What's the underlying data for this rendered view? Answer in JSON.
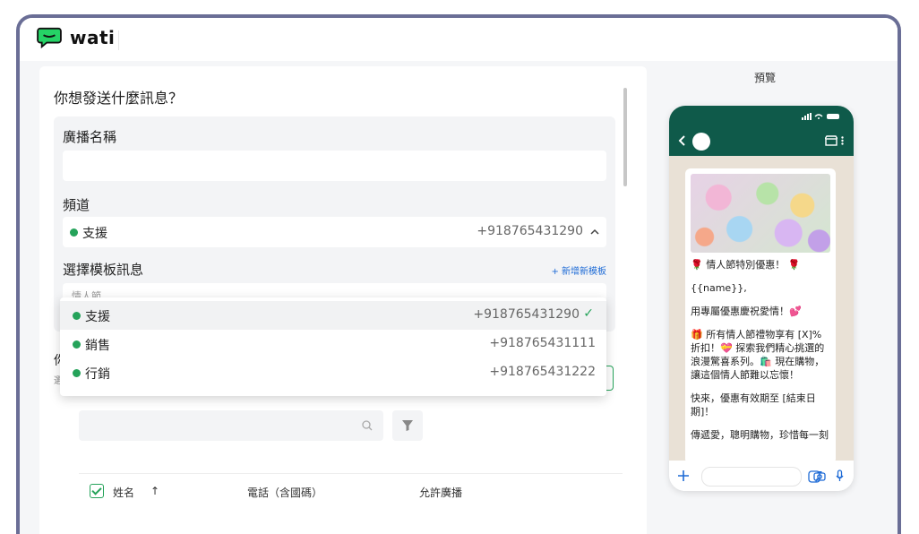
{
  "app": {
    "logo_text": "wati"
  },
  "form": {
    "question": "你想發送什麼訊息？",
    "broadcast_name_label": "廣播名稱",
    "broadcast_name_value": "",
    "channel_label": "頻道",
    "channel_selected": {
      "name": "支援",
      "number": "+918765431290"
    },
    "template_label": "選擇模板訊息",
    "new_template_link": "+ 新增新模板",
    "template_value": "情人節"
  },
  "channel_dropdown": {
    "options": [
      {
        "name": "支援",
        "number": "+918765431290",
        "selected": true
      },
      {
        "name": "銷售",
        "number": "+918765431111",
        "selected": false
      },
      {
        "name": "行銷",
        "number": "+918765431222",
        "selected": false
      }
    ]
  },
  "contacts": {
    "partial_heading": "你",
    "partial_sub": "選",
    "search_placeholder": "",
    "columns": [
      "姓名",
      "電話（含國碼）",
      "允許廣播"
    ],
    "sort_indicator": "↑"
  },
  "preview": {
    "label": "預覽",
    "message_lines": [
      "🌹 情人節特別優惠！ 🌹",
      "{{name}},",
      "用專屬優惠慶祝愛情！💕",
      "🎁 所有情人節禮物享有 [X]% 折扣！💝 探索我們精心挑選的浪漫驚喜系列。🛍️ 現在購物，讓這個情人節難以忘懷！",
      "快來，優惠有效期至 [結束日期]！",
      "傳遞愛，聰明購物，珍惜每一刻"
    ]
  },
  "colors": {
    "brand_green": "#25a35a",
    "header_green": "#0f5a4a",
    "frame": "#6a6e96",
    "link_blue": "#1e6bd6"
  },
  "icons": [
    "chevron-up-icon",
    "check-icon",
    "search-icon",
    "filter-icon",
    "back-arrow-icon",
    "store-icon",
    "more-icon",
    "plus-icon",
    "sticker-icon",
    "camera-icon",
    "mic-icon",
    "whatsapp-dot-icon"
  ]
}
